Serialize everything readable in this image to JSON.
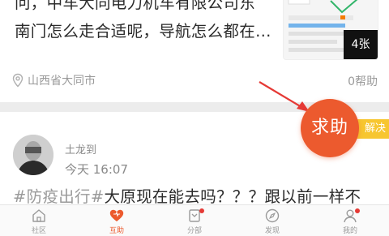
{
  "post1": {
    "line1": "问，中车大同电力机车有限公司东",
    "line2": "南门怎么走合适呢，导航怎么都在…",
    "image_count": "4张",
    "location": "山西省大同市",
    "help_count": "0帮助"
  },
  "post2": {
    "username": "土龙到",
    "time": "今天 16:07",
    "hashtag": "#防疫出行#",
    "text": "大原现在能去吗？？？跟以前一样不",
    "status_badge": "解决"
  },
  "float_button": {
    "label": "求助"
  },
  "colors": {
    "accent": "#ec5a2e",
    "badge": "#f7c630",
    "annotation_arrow": "#e53935"
  },
  "nav": {
    "items": [
      {
        "label": "社区",
        "icon": "home-icon"
      },
      {
        "label": "互助",
        "icon": "heart-icon",
        "active": true
      },
      {
        "label": "分部",
        "icon": "branch-icon"
      },
      {
        "label": "发现",
        "icon": "compass-icon"
      },
      {
        "label": "我的",
        "icon": "user-icon"
      }
    ]
  }
}
